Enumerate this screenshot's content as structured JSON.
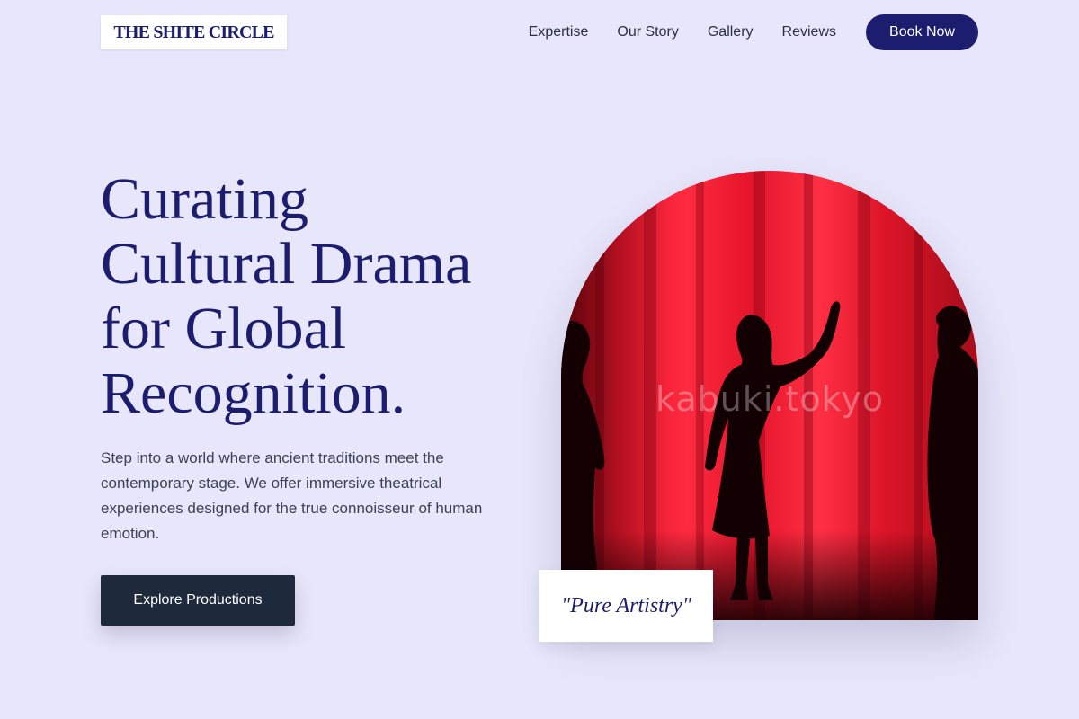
{
  "header": {
    "logo": "THE SHITE CIRCLE",
    "nav": [
      "Expertise",
      "Our Story",
      "Gallery",
      "Reviews"
    ],
    "cta": "Book Now"
  },
  "hero": {
    "headline_lines": [
      "Curating",
      "Cultural Drama",
      "for Global",
      "Recognition."
    ],
    "lead": "Step into a world where ancient traditions meet the contemporary stage. We offer immersive theatrical experiences designed for the true connoisseur of human emotion.",
    "cta": "Explore Productions"
  },
  "image": {
    "watermark": "kabuki.tokyo",
    "quote": "\"Pure Artistry\""
  },
  "colors": {
    "background": "#e8e6fa",
    "brand": "#1c1d6e",
    "dark_button": "#1e293b",
    "curtain_red": "#e3162c"
  }
}
